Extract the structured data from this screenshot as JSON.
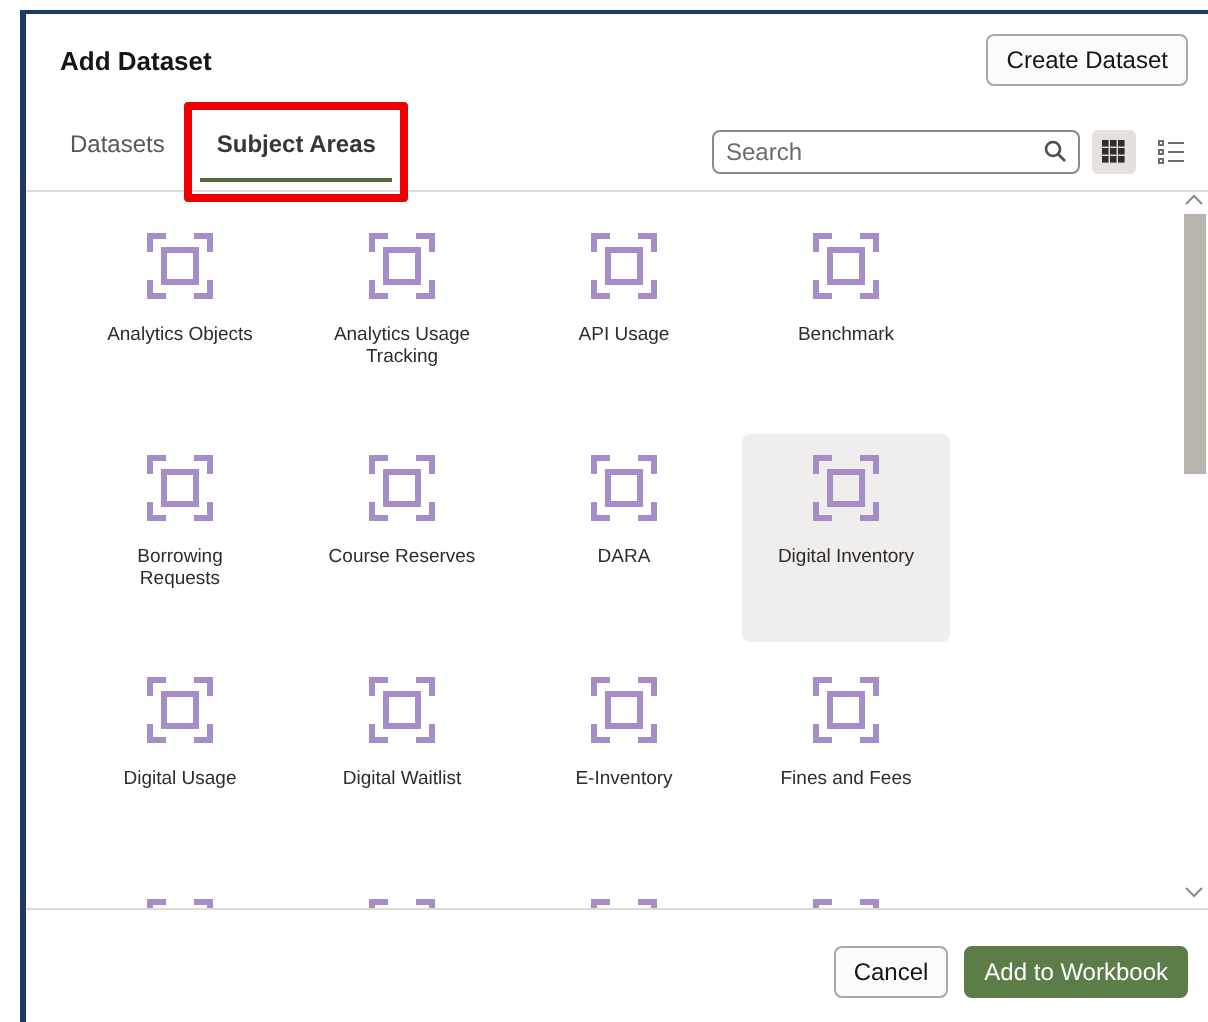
{
  "dialog": {
    "title": "Add Dataset",
    "create_button": "Create Dataset"
  },
  "tabs": [
    {
      "label": "Datasets",
      "selected": false
    },
    {
      "label": "Subject Areas",
      "selected": true,
      "highlighted": true
    }
  ],
  "search": {
    "placeholder": "Search"
  },
  "views": [
    {
      "kind": "grid",
      "selected": true
    },
    {
      "kind": "list",
      "selected": false
    }
  ],
  "tiles": [
    {
      "kind": "full",
      "label": "Analytics Objects",
      "selected": false
    },
    {
      "kind": "full",
      "label": "Analytics Usage Tracking",
      "selected": false
    },
    {
      "kind": "full",
      "label": "API Usage",
      "selected": false
    },
    {
      "kind": "full",
      "label": "Benchmark",
      "selected": false
    },
    {
      "kind": "full",
      "label": "Borrowing Requests",
      "selected": false
    },
    {
      "kind": "full",
      "label": "Course Reserves",
      "selected": false
    },
    {
      "kind": "full",
      "label": "DARA",
      "selected": false
    },
    {
      "kind": "full",
      "label": "Digital Inventory",
      "selected": true
    },
    {
      "kind": "full",
      "label": "Digital Usage",
      "selected": false
    },
    {
      "kind": "full",
      "label": "Digital Waitlist",
      "selected": false
    },
    {
      "kind": "full",
      "label": "E-Inventory",
      "selected": false
    },
    {
      "kind": "full",
      "label": "Fines and Fees",
      "selected": false
    },
    {
      "kind": "cut"
    },
    {
      "kind": "cut"
    },
    {
      "kind": "cut"
    },
    {
      "kind": "cut"
    }
  ],
  "footer": {
    "cancel": "Cancel",
    "confirm": "Add to Workbook"
  }
}
